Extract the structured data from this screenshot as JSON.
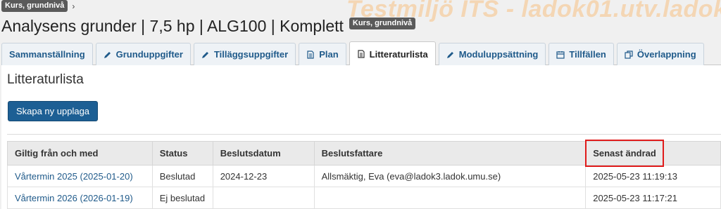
{
  "watermark": "Testmiljö ITS - ladok01.utv.ladok",
  "breadcrumb": {
    "badge": "Kurs, grundnivå",
    "separator": "›"
  },
  "header": {
    "title": "Analysens grunder | 7,5 hp | ALG100 | Komplett",
    "badge": "Kurs, grundnivå"
  },
  "tabs": [
    {
      "label": "Sammanställning",
      "icon": "none"
    },
    {
      "label": "Grunduppgifter",
      "icon": "pencil-icon"
    },
    {
      "label": "Tilläggsuppgifter",
      "icon": "pencil-icon"
    },
    {
      "label": "Plan",
      "icon": "document-icon"
    },
    {
      "label": "Litteraturlista",
      "icon": "document-icon",
      "active": true
    },
    {
      "label": "Moduluppsättning",
      "icon": "pencil-icon"
    },
    {
      "label": "Tillfällen",
      "icon": "calendar-icon"
    },
    {
      "label": "Överlappning",
      "icon": "copy-icon"
    }
  ],
  "main": {
    "title": "Litteraturlista",
    "new_button": "Skapa ny upplaga"
  },
  "table": {
    "headers": [
      "Giltig från och med",
      "Status",
      "Beslutsdatum",
      "Beslutsfattare",
      "Senast ändrad"
    ],
    "rows": [
      [
        "Vårtermin 2025 (2025-01-20)",
        "Beslutad",
        "2024-12-23",
        "Allsmäktig, Eva (eva@ladok3.ladok.umu.se)",
        "2025-05-23 11:19:13"
      ],
      [
        "Vårtermin 2026 (2026-01-19)",
        "Ej beslutad",
        "",
        "",
        "2025-05-23 11:17:21"
      ]
    ]
  },
  "colors": {
    "accent": "#1d5f94",
    "highlight": "#e01b1b",
    "watermark": "#f4d6b4"
  }
}
